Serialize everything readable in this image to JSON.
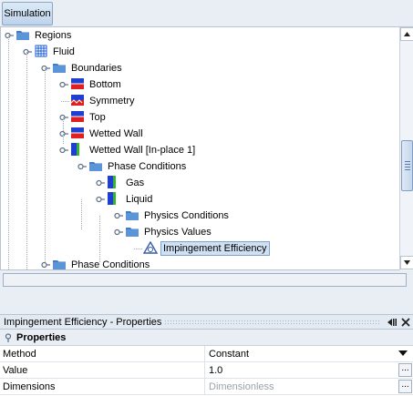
{
  "tabs": {
    "simulation": "Simulation"
  },
  "tree": {
    "nodes": [
      {
        "label": "Regions",
        "icon": "folder-icon"
      },
      {
        "label": "Fluid",
        "icon": "region-icon"
      },
      {
        "label": "Boundaries",
        "icon": "folder-icon"
      },
      {
        "label": "Bottom",
        "icon": "wall-boundary-icon"
      },
      {
        "label": "Symmetry",
        "icon": "symmetry-boundary-icon"
      },
      {
        "label": "Top",
        "icon": "wall-boundary-icon"
      },
      {
        "label": "Wetted Wall",
        "icon": "wall-boundary-icon"
      },
      {
        "label": "Wetted Wall [In-place 1]",
        "icon": "interface-boundary-icon"
      },
      {
        "label": "Phase Conditions",
        "icon": "folder-icon"
      },
      {
        "label": "Gas",
        "icon": "phase-icon"
      },
      {
        "label": "Liquid",
        "icon": "phase-icon"
      },
      {
        "label": "Physics Conditions",
        "icon": "folder-icon"
      },
      {
        "label": "Physics Values",
        "icon": "folder-icon"
      },
      {
        "label": "Impingement Efficiency",
        "icon": "physics-value-icon"
      },
      {
        "label": "Phase Conditions",
        "icon": "folder-icon"
      }
    ]
  },
  "properties": {
    "title": "Impingement Efficiency - Properties",
    "group": "Properties",
    "rows": [
      {
        "name": "Method",
        "value": "Constant"
      },
      {
        "name": "Value",
        "value": "1.0"
      },
      {
        "name": "Dimensions",
        "value": "Dimensionless"
      }
    ],
    "ellipsis": "..."
  },
  "colors": {
    "accent": "#cfe0f3",
    "panel": "#e9eef4",
    "folder": "#3f7cc4"
  }
}
